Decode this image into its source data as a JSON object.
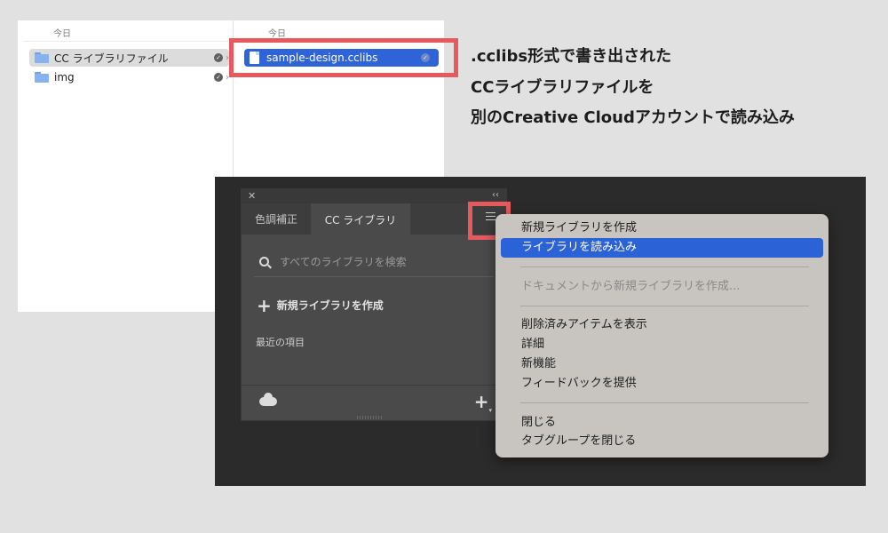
{
  "finder": {
    "col1_header": "今日",
    "col2_header": "今日",
    "col1_items": [
      {
        "name": "CC ライブラリファイル",
        "selected": "gray"
      },
      {
        "name": "img",
        "selected": "none"
      }
    ],
    "col2_items": [
      {
        "name": "sample-design.cclibs",
        "selected": "blue"
      }
    ]
  },
  "annotation": {
    "line1": ".cclibs形式で書き出された",
    "line2": "CCライブラリファイルを",
    "line3": "別のCreative Cloudアカウントで読み込み"
  },
  "panel": {
    "tabs": [
      "色調補正",
      "CC ライブラリ"
    ],
    "active_tab": "CC ライブラリ",
    "search_placeholder": "すべてのライブラリを検索",
    "new_library_label": "新規ライブラリを作成",
    "recent_label": "最近の項目"
  },
  "menu": {
    "groups": [
      [
        {
          "label": "新規ライブラリを作成",
          "state": "normal"
        },
        {
          "label": "ライブラリを読み込み",
          "state": "highlighted"
        }
      ],
      [
        {
          "label": "ドキュメントから新規ライブラリを作成...",
          "state": "disabled"
        }
      ],
      [
        {
          "label": "削除済みアイテムを表示",
          "state": "normal"
        },
        {
          "label": "詳細",
          "state": "normal"
        },
        {
          "label": "新機能",
          "state": "normal"
        },
        {
          "label": "フィードバックを提供",
          "state": "normal"
        }
      ],
      [
        {
          "label": "閉じる",
          "state": "normal"
        },
        {
          "label": "タブグループを閉じる",
          "state": "normal"
        }
      ]
    ]
  },
  "colors": {
    "highlight_red": "#e65a5d",
    "selection_blue": "#2f63d8",
    "menu_background": "#c8c5c1",
    "workspace_background": "#2b2b2b"
  }
}
